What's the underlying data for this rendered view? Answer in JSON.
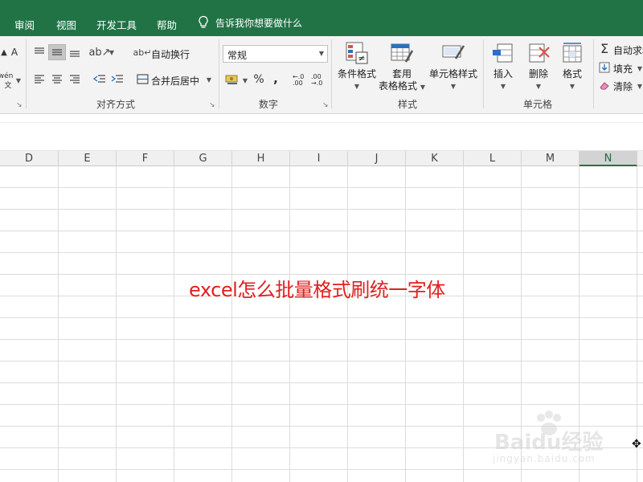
{
  "window": {
    "title": ""
  },
  "tabs": [
    {
      "label": "审阅"
    },
    {
      "label": "视图"
    },
    {
      "label": "开发工具"
    },
    {
      "label": "帮助"
    }
  ],
  "tell_me": {
    "text": "告诉我你想要做什么",
    "icon": "lightbulb-icon"
  },
  "ribbon": {
    "font_group": {
      "partial_label": "A",
      "phonetic": "wén",
      "phonetic_char": "文"
    },
    "alignment": {
      "wrap_text": "自动换行",
      "merge_center": "合并后居中",
      "group_label": "对齐方式"
    },
    "number": {
      "format_value": "常规",
      "percent": "%",
      "comma": ",",
      "increase_decimal": "←.0 .00",
      "decrease_decimal": ".00 →.0",
      "group_label": "数字"
    },
    "styles": {
      "conditional": "条件格式",
      "table_line1": "套用",
      "table_line2": "表格格式",
      "cell_styles": "单元格样式",
      "group_label": "样式"
    },
    "cells": {
      "insert": "插入",
      "delete": "删除",
      "format": "格式",
      "group_label": "单元格"
    },
    "editing": {
      "autosum": "自动求和",
      "fill": "填充",
      "clear": "清除"
    }
  },
  "grid": {
    "columns": [
      "D",
      "E",
      "F",
      "G",
      "H",
      "I",
      "J",
      "K",
      "L",
      "M",
      "N"
    ],
    "selected_column": "N",
    "cell_text": "excel怎么批量格式刷统一字体",
    "cell_text_color": "#e02020"
  },
  "watermark": {
    "main": "Baidu经验",
    "sub": "jingyan.baidu.com"
  },
  "colors": {
    "accent": "#217346",
    "ribbon_bg": "#f3f3f3"
  }
}
